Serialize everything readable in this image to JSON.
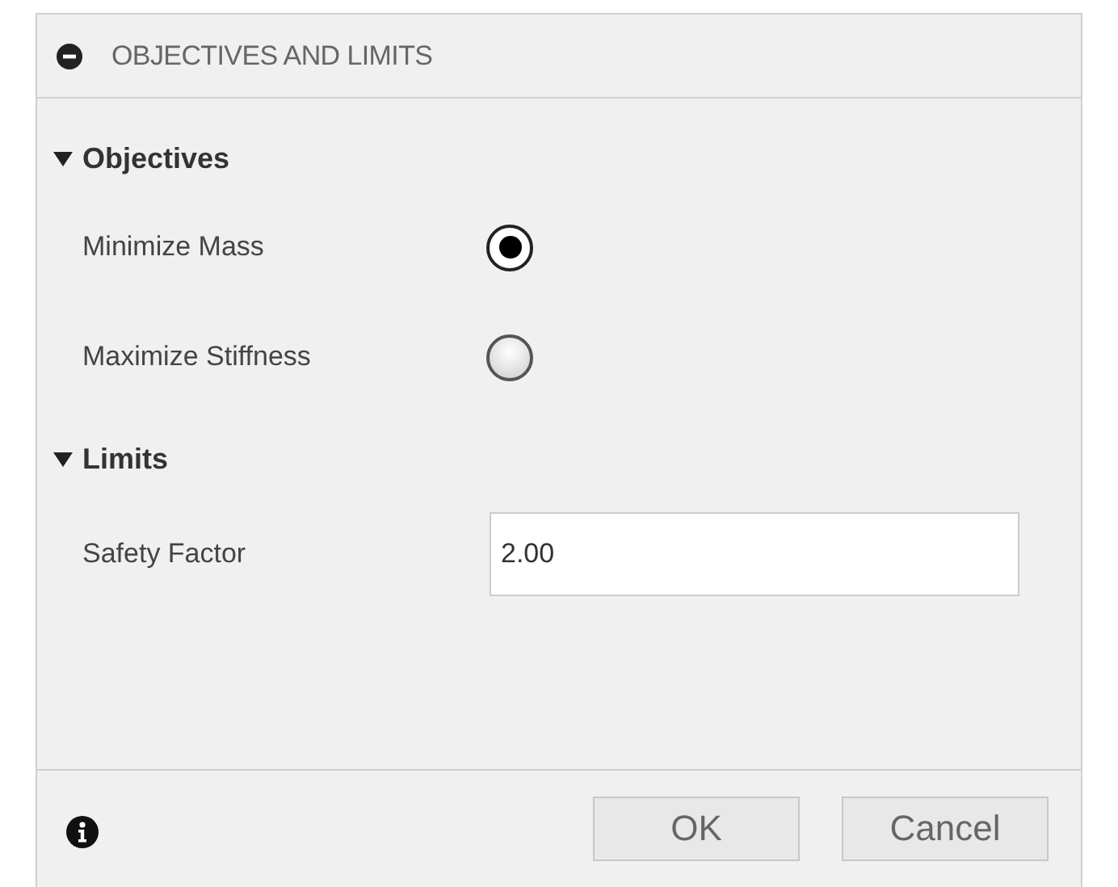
{
  "panel": {
    "title": "OBJECTIVES AND LIMITS",
    "expanded": true
  },
  "sections": [
    {
      "title": "Objectives",
      "expanded": true,
      "rows": [
        {
          "kind": "radio",
          "label": "Minimize Mass",
          "selected": true
        },
        {
          "kind": "radio",
          "label": "Maximize Stiffness",
          "selected": false
        }
      ]
    },
    {
      "title": "Limits",
      "expanded": true,
      "rows": [
        {
          "kind": "field",
          "label": "Safety Factor",
          "value": "2.00"
        }
      ]
    }
  ],
  "buttons": [
    "OK",
    "Cancel"
  ]
}
